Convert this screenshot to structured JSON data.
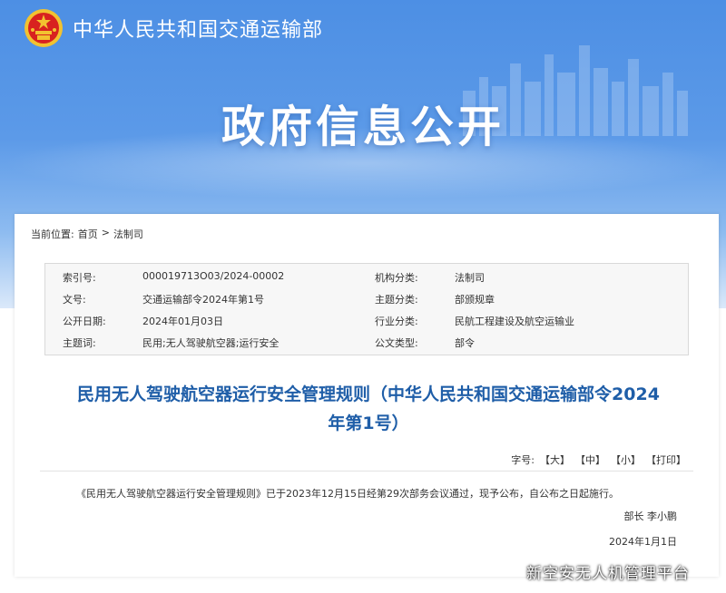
{
  "site": {
    "name": "中华人民共和国交通运输部",
    "emblem_icon": "national-emblem-icon"
  },
  "banner": {
    "title": "政府信息公开"
  },
  "breadcrumb": {
    "label": "当前位置:",
    "home": "首页",
    "separator": ">",
    "current": "法制司"
  },
  "info": {
    "rows": [
      {
        "k1": "索引号:",
        "v1": "000019713O03/2024-00002",
        "k2": "机构分类:",
        "v2": "法制司"
      },
      {
        "k1": "文号:",
        "v1": "交通运输部令2024年第1号",
        "k2": "主题分类:",
        "v2": "部颁规章"
      },
      {
        "k1": "公开日期:",
        "v1": "2024年01月03日",
        "k2": "行业分类:",
        "v2": "民航工程建设及航空运输业"
      },
      {
        "k1": "主题词:",
        "v1": "民用;无人驾驶航空器;运行安全",
        "k2": "公文类型:",
        "v2": "部令"
      }
    ]
  },
  "document": {
    "title_line1": "民用无人驾驶航空器运行安全管理规则（中华人民共和国交通运输部令2024",
    "title_line2": "年第1号）",
    "font_size_label": "字号:",
    "btn_large": "【大】",
    "btn_medium": "【中】",
    "btn_small": "【小】",
    "btn_print": "【打印】",
    "body": "《民用无人驾驶航空器运行安全管理规则》已于2023年12月15日经第29次部务会议通过，现予公布，自公布之日起施行。",
    "signer": "部长  李小鹏",
    "date": "2024年1月1日"
  },
  "watermark": "新空安无人机管理平台",
  "colors": {
    "banner_blue": "#4d8fe4",
    "title_blue": "#1f5ea8"
  }
}
